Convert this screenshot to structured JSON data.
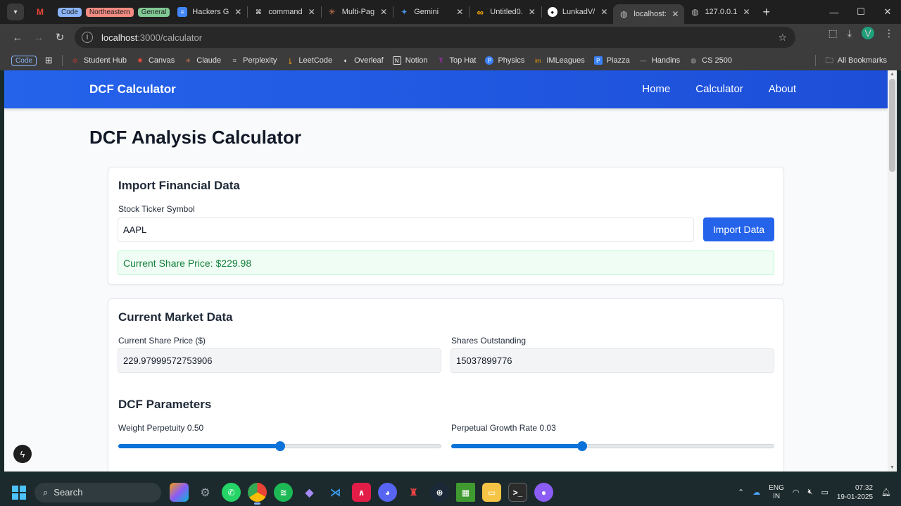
{
  "browser": {
    "tabs": [
      {
        "label": "",
        "icon": "gmail-icon",
        "color": "#ea4335",
        "glyph": "M"
      },
      {
        "label": "Code",
        "chip": true,
        "chip_bg": "#8ab4f8",
        "chip_fg": "#1f1f1f"
      },
      {
        "label": "Northeastern",
        "chip": true,
        "chip_bg": "#f28b82",
        "chip_fg": "#1f1f1f"
      },
      {
        "label": "General",
        "chip": true,
        "chip_bg": "#81c995",
        "chip_fg": "#1f1f1f"
      },
      {
        "label": "Hackers G",
        "icon": "docs-icon",
        "color": "#4285f4",
        "glyph": "≡"
      },
      {
        "label": "command",
        "icon": "command-icon",
        "color": "#333",
        "glyph": "⌘"
      },
      {
        "label": "Multi-Pag",
        "icon": "claude-icon",
        "color": "#d97757",
        "glyph": "✳"
      },
      {
        "label": "Gemini",
        "icon": "gemini-icon",
        "color": "#4a90e2",
        "glyph": "✦"
      },
      {
        "label": "Untitled0.",
        "icon": "colab-icon",
        "color": "#f9ab00",
        "glyph": "∞"
      },
      {
        "label": "LunkadV/",
        "icon": "github-icon",
        "color": "#000",
        "glyph": "●"
      },
      {
        "label": "localhost:",
        "icon": "globe-icon",
        "color": "#666",
        "glyph": "◍",
        "active": true
      },
      {
        "label": "127.0.0.1:",
        "icon": "globe-icon",
        "color": "#666",
        "glyph": "◍"
      }
    ],
    "url_host": "localhost",
    "url_path": ":3000/calculator",
    "profile_initial": "V",
    "bookmarks": [
      {
        "label": "Student Hub",
        "glyph": "⊘",
        "color": "#c0392b"
      },
      {
        "label": "Canvas",
        "glyph": "✺",
        "color": "#e74c3c"
      },
      {
        "label": "Claude",
        "glyph": "✳",
        "color": "#d97757"
      },
      {
        "label": "Perplexity",
        "glyph": "⌗",
        "color": "#ccc"
      },
      {
        "label": "LeetCode",
        "glyph": "ȴ",
        "color": "#f89f1b"
      },
      {
        "label": "Overleaf",
        "glyph": "◐",
        "color": "#fff"
      },
      {
        "label": "Notion",
        "glyph": "N",
        "color": "#fff"
      },
      {
        "label": "Top Hat",
        "glyph": "T",
        "color": "#c026d3"
      },
      {
        "label": "Physics",
        "glyph": "P",
        "color": "#3b82f6"
      },
      {
        "label": "IMLeagues",
        "glyph": "im",
        "color": "#f59e0b"
      },
      {
        "label": "Piazza",
        "glyph": "P",
        "color": "#3b82f6"
      },
      {
        "label": "Handins",
        "glyph": "—",
        "color": "#aaa"
      },
      {
        "label": "CS 2500",
        "glyph": "◍",
        "color": "#aaa"
      }
    ],
    "code_chip": "Code",
    "all_bookmarks": "All Bookmarks"
  },
  "site": {
    "brand": "DCF Calculator",
    "nav": [
      "Home",
      "Calculator",
      "About"
    ],
    "page_title": "DCF Analysis Calculator"
  },
  "import": {
    "heading": "Import Financial Data",
    "ticker_label": "Stock Ticker Symbol",
    "ticker_value": "AAPL",
    "button": "Import Data",
    "price_message": "Current Share Price: $229.98"
  },
  "market": {
    "heading": "Current Market Data",
    "price_label": "Current Share Price ($)",
    "price_value": "229.97999572753906",
    "shares_label": "Shares Outstanding",
    "shares_value": "15037899776"
  },
  "params": {
    "heading": "DCF Parameters",
    "weight_label": "Weight Perpetuity 0.50",
    "weight_value": 0.5,
    "growth_label": "Perpetual Growth Rate 0.03",
    "growth_fraction": 0.405
  },
  "taskbar": {
    "search": "Search",
    "lang_1": "ENG",
    "lang_2": "IN",
    "time": "07:32",
    "date": "19-01-2025"
  },
  "colors": {
    "primary": "#2563eb",
    "success_bg": "#f0fdf4",
    "success_text": "#15803d"
  }
}
